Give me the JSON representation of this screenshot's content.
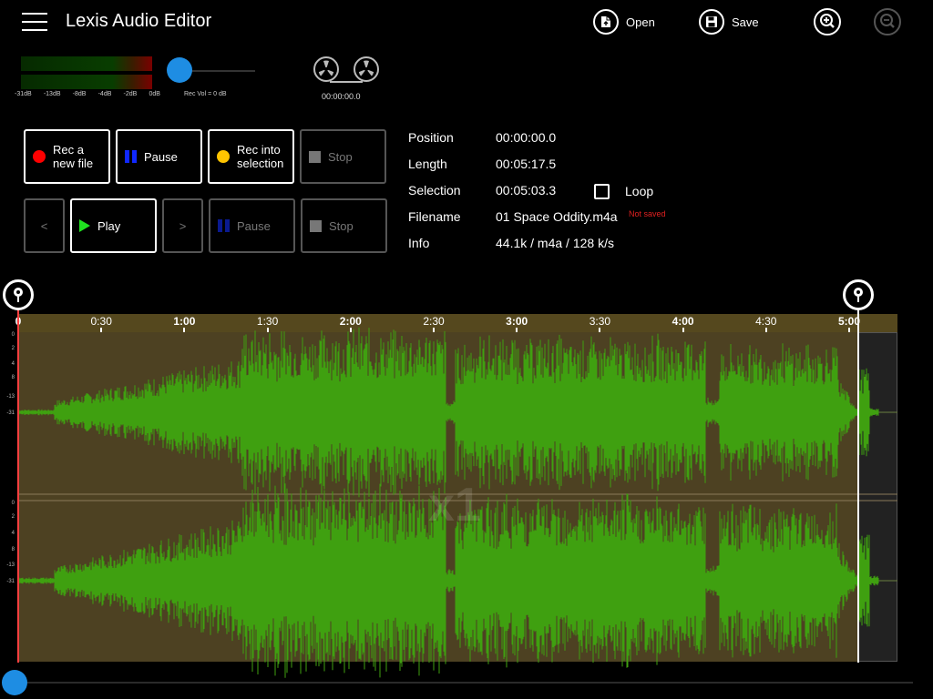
{
  "header": {
    "title": "Lexis Audio Editor",
    "open_label": "Open",
    "save_label": "Save"
  },
  "meters": {
    "scale": [
      "-31dB",
      "-13dB",
      "-8dB",
      "-4dB",
      "-2dB",
      "0dB"
    ],
    "left_level": 0,
    "right_level": 0
  },
  "rec_volume": {
    "label": "Rec Vol = 0 dB",
    "value": 0
  },
  "tape": {
    "time": "00:00:00.0"
  },
  "controls": {
    "rec_new_line1": "Rec a",
    "rec_new_line2": "new file",
    "pause_rec": "Pause",
    "rec_sel_line1": "Rec into",
    "rec_sel_line2": "selection",
    "stop_rec": "Stop",
    "prev": "<",
    "play": "Play",
    "next": ">",
    "pause_play": "Pause",
    "stop_play": "Stop"
  },
  "info": {
    "position_label": "Position",
    "position_value": "00:00:00.0",
    "length_label": "Length",
    "length_value": "00:05:17.5",
    "selection_label": "Selection",
    "selection_value": "00:05:03.3",
    "loop_label": "Loop",
    "loop_checked": false,
    "filename_label": "Filename",
    "filename_value": "01 Space Oddity.m4a",
    "not_saved": "Not saved",
    "info_label": "Info",
    "info_value": "44.1k / m4a / 128 k/s"
  },
  "timeline": {
    "labels": [
      "0",
      "0:30",
      "1:00",
      "1:30",
      "2:00",
      "2:30",
      "3:00",
      "3:30",
      "4:00",
      "4:30",
      "5:00"
    ],
    "bold": [
      true,
      false,
      true,
      false,
      true,
      false,
      true,
      false,
      true,
      false,
      true
    ]
  },
  "db_scale": [
    "0",
    "2",
    "4",
    "8",
    "-13",
    "-31"
  ],
  "zoom_level": "x1",
  "colors": {
    "waveform": "#3fa010",
    "accent": "#1e8de3",
    "rec_red": "#ff0000",
    "rec_yellow": "#ffc400",
    "pause_blue": "#1028ff",
    "play_green": "#20e020"
  },
  "scrubber": {
    "position": 0
  }
}
